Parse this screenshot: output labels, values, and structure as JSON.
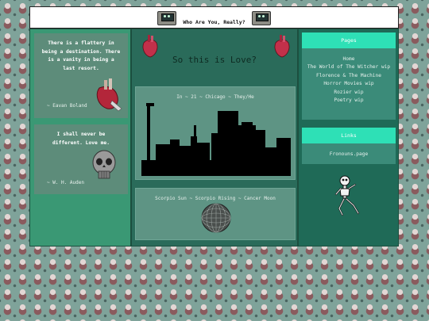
{
  "header": {
    "title": "Who Are You, Really?"
  },
  "left": {
    "quotes": [
      {
        "text": "There is a flattery in being a destination. There is a vanity in being a last resort.",
        "author": "~ Eavan Boland"
      },
      {
        "text": "I shall never be different. Love me.",
        "author": "~ W. H. Auden"
      }
    ]
  },
  "middle": {
    "title": "So this is Love?",
    "details": "In ~ 21 ~ Chicago ~ They/He",
    "signs": "Scorpio Sun ~ Scorpio Rising ~ Cancer Moon"
  },
  "right": {
    "pages_heading": "Pages",
    "pages": [
      "Home",
      "The World of The Witcher wip",
      "Florence & The Machine",
      "Horror Movies wip",
      "Rozier wip",
      "Poetry wip"
    ],
    "links_heading": "Links",
    "links": [
      "Fronouns.page"
    ]
  },
  "colors": {
    "header_bg": "#ffffff",
    "nav_heading": "#2ee0b6",
    "panel_dark": "#2a6b5a"
  },
  "icons": [
    "retro-computer-icon",
    "anatomical-heart-icon",
    "skull-icon",
    "city-skyline",
    "dancing-skeleton-icon"
  ]
}
